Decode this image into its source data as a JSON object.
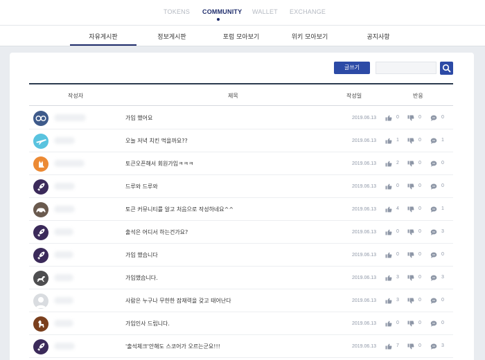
{
  "topnav": {
    "items": [
      {
        "label": "TOKENS",
        "active": false
      },
      {
        "label": "COMMUNITY",
        "active": true
      },
      {
        "label": "WALLET",
        "active": false
      },
      {
        "label": "EXCHANGE",
        "active": false
      }
    ]
  },
  "subnav": {
    "tabs": [
      {
        "label": "자유게시판",
        "active": true
      },
      {
        "label": "정보게시판",
        "active": false
      },
      {
        "label": "포럼 모아보기",
        "active": false
      },
      {
        "label": "위키 모아보기",
        "active": false
      },
      {
        "label": "공지사항",
        "active": false
      }
    ]
  },
  "toolbar": {
    "write_label": "글쓰기",
    "search_value": ""
  },
  "table": {
    "headers": {
      "author": "작성자",
      "title": "제목",
      "date": "작성일",
      "reactions": "반응"
    },
    "rows": [
      {
        "avatar": "glasses",
        "title": "가입 했어요",
        "date": "2019.06.13",
        "likes": "0",
        "dislikes": "0",
        "comments": "0"
      },
      {
        "avatar": "plane",
        "title": "오늘 저녁 치킨 먹을까요??",
        "date": "2019.06.13",
        "likes": "1",
        "dislikes": "0",
        "comments": "1"
      },
      {
        "avatar": "cat",
        "title": "토큰오픈해서 회원가입ㅋㅋㅋ",
        "date": "2019.06.13",
        "likes": "2",
        "dislikes": "0",
        "comments": "0"
      },
      {
        "avatar": "rocket",
        "title": "드루와 드루와",
        "date": "2019.06.13",
        "likes": "0",
        "dislikes": "0",
        "comments": "0"
      },
      {
        "avatar": "car",
        "title": "토큰 커뮤니티를 알고 처음으로 작성하네요^^",
        "date": "2019.06.13",
        "likes": "4",
        "dislikes": "0",
        "comments": "1"
      },
      {
        "avatar": "rocket",
        "title": "출석은 어디서 하는건가요?",
        "date": "2019.06.13",
        "likes": "0",
        "dislikes": "0",
        "comments": "3"
      },
      {
        "avatar": "rocket",
        "title": "가입 했습니다",
        "date": "2019.06.13",
        "likes": "0",
        "dislikes": "0",
        "comments": "0"
      },
      {
        "avatar": "dog-run",
        "title": "가입했습니다.",
        "date": "2019.06.13",
        "likes": "3",
        "dislikes": "0",
        "comments": "3"
      },
      {
        "avatar": "default-user",
        "title": "사람은 누구나 무한한 잠재력을 갖고 태어난다",
        "date": "2019.06.13",
        "likes": "3",
        "dislikes": "0",
        "comments": "0"
      },
      {
        "avatar": "dog",
        "title": "가입인사 드립니다.",
        "date": "2019.06.13",
        "likes": "0",
        "dislikes": "0",
        "comments": "0"
      },
      {
        "avatar": "rocket",
        "title": "'출석체크'안해도 스코어가 오르는군요!!!",
        "date": "2019.06.13",
        "likes": "7",
        "dislikes": "0",
        "comments": "3"
      }
    ]
  }
}
